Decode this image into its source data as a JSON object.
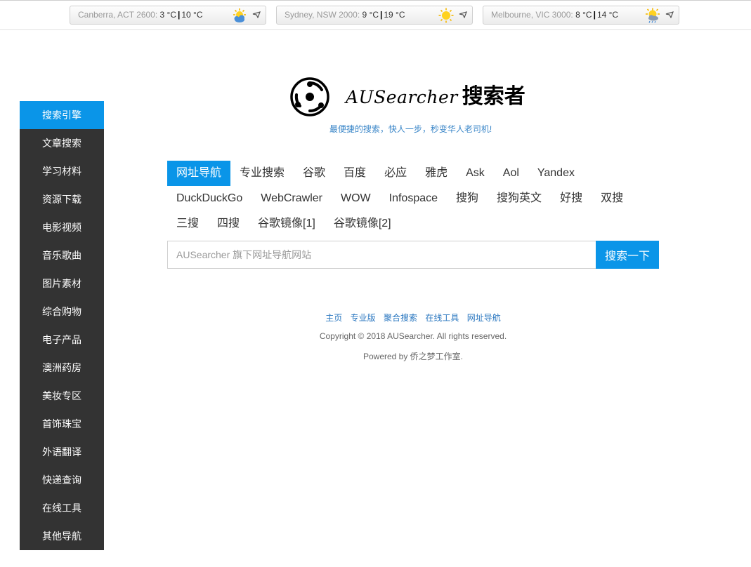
{
  "weather": [
    {
      "city": "Canberra, ACT 2600:",
      "low": "3 °C",
      "high": "10 °C",
      "icon": "sun-cloud-icon"
    },
    {
      "city": "Sydney, NSW 2000:",
      "low": "9 °C",
      "high": "19 °C",
      "icon": "sun-icon"
    },
    {
      "city": "Melbourne, VIC 3000:",
      "low": "8 °C",
      "high": "14 °C",
      "icon": "sun-rain-icon"
    }
  ],
  "sidebar": {
    "items": [
      {
        "label": "搜索引擎"
      },
      {
        "label": "文章搜索"
      },
      {
        "label": "学习材料"
      },
      {
        "label": "资源下载"
      },
      {
        "label": "电影视频"
      },
      {
        "label": "音乐歌曲"
      },
      {
        "label": "图片素材"
      },
      {
        "label": "综合购物"
      },
      {
        "label": "电子产品"
      },
      {
        "label": "澳洲药房"
      },
      {
        "label": "美妆专区"
      },
      {
        "label": "首饰珠宝"
      },
      {
        "label": "外语翻译"
      },
      {
        "label": "快递查询"
      },
      {
        "label": "在线工具"
      },
      {
        "label": "其他导航"
      }
    ],
    "active_index": 0
  },
  "brand": {
    "name_latin": "AUSearcher",
    "name_cn": "搜索者",
    "slogan": "最便捷的搜索，快人一步，秒变华人老司机!"
  },
  "tabs": [
    {
      "label": "网址导航"
    },
    {
      "label": "专业搜索"
    },
    {
      "label": "谷歌"
    },
    {
      "label": "百度"
    },
    {
      "label": "必应"
    },
    {
      "label": "雅虎"
    },
    {
      "label": "Ask"
    },
    {
      "label": "Aol"
    },
    {
      "label": "Yandex"
    },
    {
      "label": "DuckDuckGo"
    },
    {
      "label": "WebCrawler"
    },
    {
      "label": "WOW"
    },
    {
      "label": "Infospace"
    },
    {
      "label": "搜狗"
    },
    {
      "label": "搜狗英文"
    },
    {
      "label": "好搜"
    },
    {
      "label": "双搜"
    },
    {
      "label": "三搜"
    },
    {
      "label": "四搜"
    },
    {
      "label": "谷歌镜像[1]"
    },
    {
      "label": "谷歌镜像[2]"
    }
  ],
  "search": {
    "placeholder": "AUSearcher 旗下网址导航网站",
    "value": "",
    "button_label": "搜索一下"
  },
  "footer": {
    "links": [
      "主页",
      "专业版",
      "聚合搜索",
      "在线工具",
      "网址导航"
    ],
    "copyright": "Copyright © 2018 AUSearcher. All rights reserved.",
    "powered": "Powered by 侨之梦工作室."
  },
  "colors": {
    "accent": "#0a95e8",
    "sidebar_bg": "#333333",
    "link": "#2a77c0"
  }
}
